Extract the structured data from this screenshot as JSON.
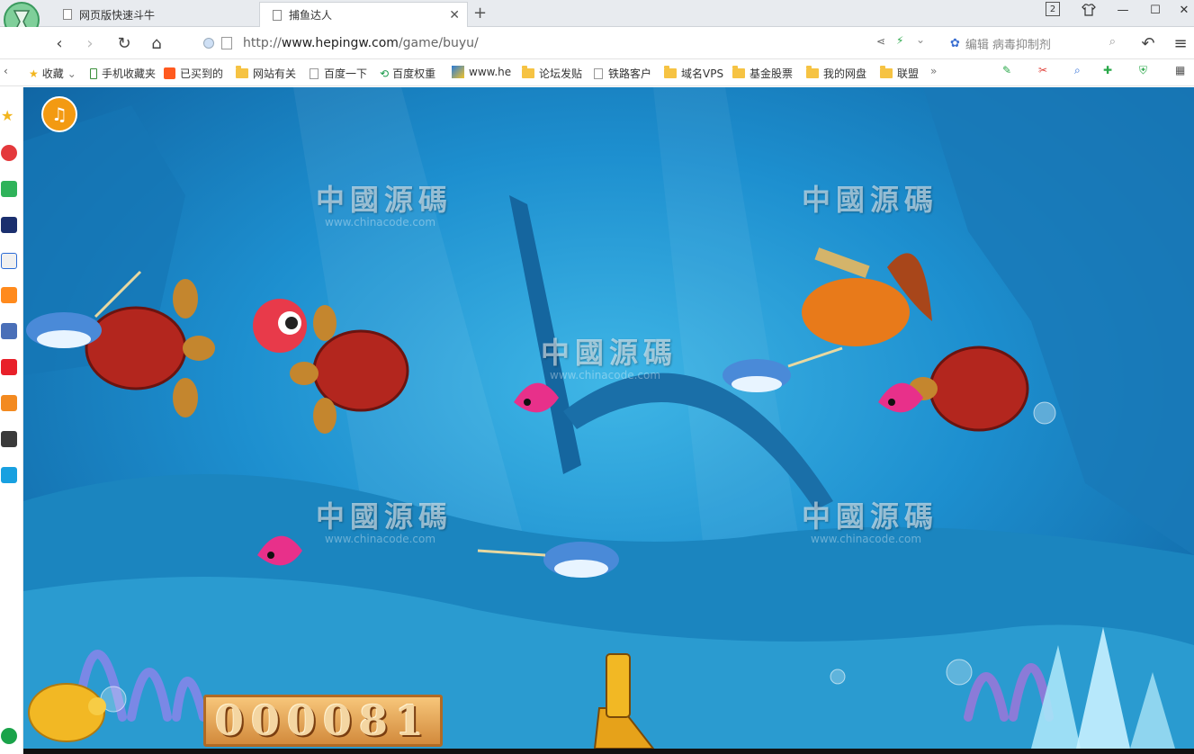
{
  "tabs": [
    {
      "title": "网页版快速斗牛"
    },
    {
      "title": "捕鱼达人"
    }
  ],
  "tab_counter": "2",
  "address": {
    "prefix": "http://",
    "host": "www.hepingw.com",
    "path": "/game/buyu/"
  },
  "search": {
    "engine_label": "编辑",
    "query": "病毒抑制剂"
  },
  "bookmarks": [
    {
      "label": "收藏",
      "type": "star"
    },
    {
      "label": "手机收藏夹",
      "type": "phone"
    },
    {
      "label": "已买到的",
      "type": "site"
    },
    {
      "label": "网站有关",
      "type": "folder"
    },
    {
      "label": "百度一下",
      "type": "page"
    },
    {
      "label": "百度权重",
      "type": "site"
    },
    {
      "label": "www.he",
      "type": "site"
    },
    {
      "label": "论坛发贴",
      "type": "folder"
    },
    {
      "label": "铁路客户",
      "type": "page"
    },
    {
      "label": "域名VPS",
      "type": "folder"
    },
    {
      "label": "基金股票",
      "type": "folder"
    },
    {
      "label": "我的网盘",
      "type": "folder"
    },
    {
      "label": "联盟",
      "type": "folder"
    }
  ],
  "game": {
    "score": "000081",
    "music_icon": "♫",
    "watermark": "中國源碼",
    "watermark_sub": "www.chinacode.com"
  }
}
